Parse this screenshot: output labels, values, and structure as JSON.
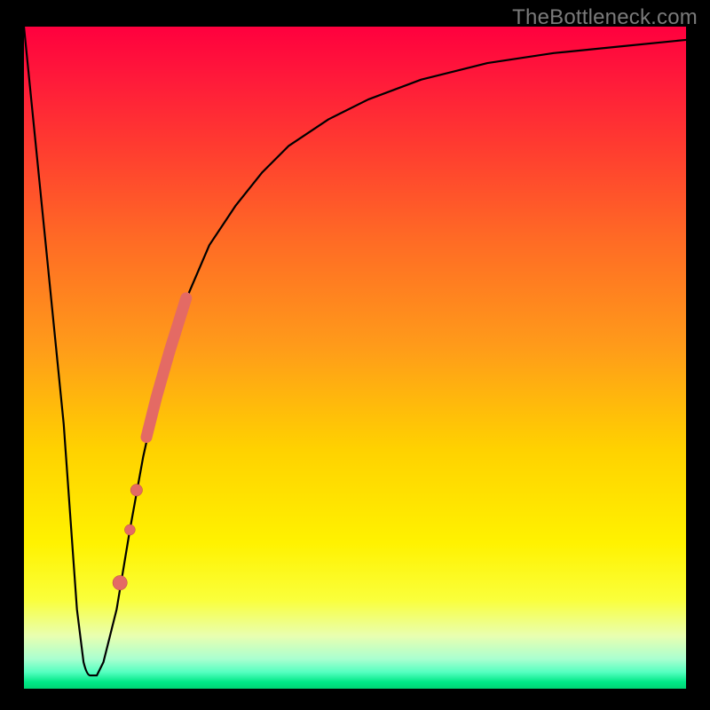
{
  "watermark": "TheBottleneck.com",
  "colors": {
    "frame": "#000000",
    "curve": "#000000",
    "marker": "#e46a64",
    "marker_stroke": "#b84a45"
  },
  "chart_data": {
    "type": "line",
    "title": "",
    "xlabel": "",
    "ylabel": "",
    "xlim": [
      0,
      100
    ],
    "ylim": [
      0,
      100
    ],
    "series": [
      {
        "name": "bottleneck-curve",
        "x": [
          0,
          3,
          6,
          8,
          9,
          10,
          11,
          12,
          14,
          16,
          18,
          20,
          22,
          25,
          28,
          32,
          36,
          40,
          46,
          52,
          60,
          70,
          80,
          90,
          100
        ],
        "y": [
          100,
          70,
          40,
          12,
          4,
          2,
          2,
          4,
          12,
          24,
          35,
          44,
          51,
          60,
          67,
          73,
          78,
          82,
          86,
          89,
          92,
          94.5,
          96,
          97,
          98
        ]
      }
    ],
    "markers": [
      {
        "name": "thick-segment",
        "type": "segment",
        "x": [
          18.5,
          24.5
        ],
        "y": [
          38,
          59
        ],
        "width": 14
      },
      {
        "name": "dot-a",
        "type": "point",
        "x": 17.0,
        "y": 30,
        "r": 7
      },
      {
        "name": "dot-b",
        "type": "point",
        "x": 16.0,
        "y": 24,
        "r": 6
      },
      {
        "name": "dot-c",
        "type": "point",
        "x": 14.5,
        "y": 16,
        "r": 8
      }
    ],
    "grid": false,
    "legend": false
  }
}
